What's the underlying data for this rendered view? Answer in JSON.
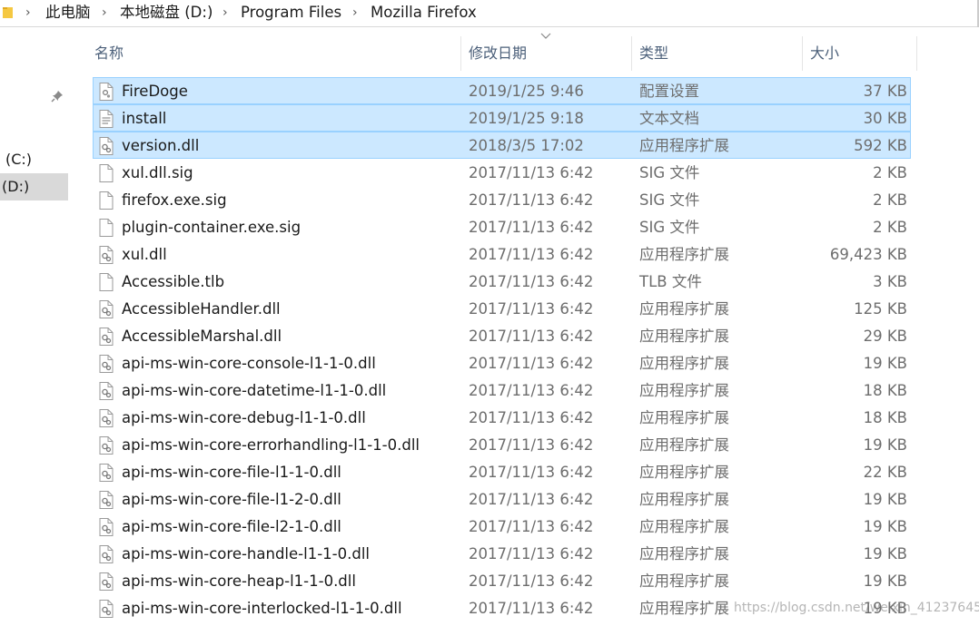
{
  "breadcrumb": [
    "此电脑",
    "本地磁盘 (D:)",
    "Program Files",
    "Mozilla Firefox"
  ],
  "nav": {
    "drive_c": "(C:)",
    "drive_d": "(D:)"
  },
  "columns": {
    "name": "名称",
    "date": "修改日期",
    "type": "类型",
    "size": "大小"
  },
  "files": [
    {
      "name": "FireDoge",
      "date": "2019/1/25 9:46",
      "type": "配置设置",
      "size": "37 KB",
      "icon": "config-file-icon",
      "selected": true
    },
    {
      "name": "install",
      "date": "2019/1/25 9:18",
      "type": "文本文档",
      "size": "30 KB",
      "icon": "text-file-icon",
      "selected": true
    },
    {
      "name": "version.dll",
      "date": "2018/3/5 17:02",
      "type": "应用程序扩展",
      "size": "592 KB",
      "icon": "dll-file-icon",
      "selected": true
    },
    {
      "name": "xul.dll.sig",
      "date": "2017/11/13 6:42",
      "type": "SIG 文件",
      "size": "2 KB",
      "icon": "blank-file-icon",
      "selected": false
    },
    {
      "name": "firefox.exe.sig",
      "date": "2017/11/13 6:42",
      "type": "SIG 文件",
      "size": "2 KB",
      "icon": "blank-file-icon",
      "selected": false
    },
    {
      "name": "plugin-container.exe.sig",
      "date": "2017/11/13 6:42",
      "type": "SIG 文件",
      "size": "2 KB",
      "icon": "blank-file-icon",
      "selected": false
    },
    {
      "name": "xul.dll",
      "date": "2017/11/13 6:42",
      "type": "应用程序扩展",
      "size": "69,423 KB",
      "icon": "dll-file-icon",
      "selected": false
    },
    {
      "name": "Accessible.tlb",
      "date": "2017/11/13 6:42",
      "type": "TLB 文件",
      "size": "3 KB",
      "icon": "blank-file-icon",
      "selected": false
    },
    {
      "name": "AccessibleHandler.dll",
      "date": "2017/11/13 6:42",
      "type": "应用程序扩展",
      "size": "125 KB",
      "icon": "dll-file-icon",
      "selected": false
    },
    {
      "name": "AccessibleMarshal.dll",
      "date": "2017/11/13 6:42",
      "type": "应用程序扩展",
      "size": "29 KB",
      "icon": "dll-file-icon",
      "selected": false
    },
    {
      "name": "api-ms-win-core-console-l1-1-0.dll",
      "date": "2017/11/13 6:42",
      "type": "应用程序扩展",
      "size": "19 KB",
      "icon": "dll-file-icon",
      "selected": false
    },
    {
      "name": "api-ms-win-core-datetime-l1-1-0.dll",
      "date": "2017/11/13 6:42",
      "type": "应用程序扩展",
      "size": "18 KB",
      "icon": "dll-file-icon",
      "selected": false
    },
    {
      "name": "api-ms-win-core-debug-l1-1-0.dll",
      "date": "2017/11/13 6:42",
      "type": "应用程序扩展",
      "size": "18 KB",
      "icon": "dll-file-icon",
      "selected": false
    },
    {
      "name": "api-ms-win-core-errorhandling-l1-1-0.dll",
      "date": "2017/11/13 6:42",
      "type": "应用程序扩展",
      "size": "19 KB",
      "icon": "dll-file-icon",
      "selected": false
    },
    {
      "name": "api-ms-win-core-file-l1-1-0.dll",
      "date": "2017/11/13 6:42",
      "type": "应用程序扩展",
      "size": "22 KB",
      "icon": "dll-file-icon",
      "selected": false
    },
    {
      "name": "api-ms-win-core-file-l1-2-0.dll",
      "date": "2017/11/13 6:42",
      "type": "应用程序扩展",
      "size": "19 KB",
      "icon": "dll-file-icon",
      "selected": false
    },
    {
      "name": "api-ms-win-core-file-l2-1-0.dll",
      "date": "2017/11/13 6:42",
      "type": "应用程序扩展",
      "size": "19 KB",
      "icon": "dll-file-icon",
      "selected": false
    },
    {
      "name": "api-ms-win-core-handle-l1-1-0.dll",
      "date": "2017/11/13 6:42",
      "type": "应用程序扩展",
      "size": "19 KB",
      "icon": "dll-file-icon",
      "selected": false
    },
    {
      "name": "api-ms-win-core-heap-l1-1-0.dll",
      "date": "2017/11/13 6:42",
      "type": "应用程序扩展",
      "size": "19 KB",
      "icon": "dll-file-icon",
      "selected": false
    },
    {
      "name": "api-ms-win-core-interlocked-l1-1-0.dll",
      "date": "2017/11/13 6:42",
      "type": "应用程序扩展",
      "size": "19 KB",
      "icon": "dll-file-icon",
      "selected": false
    }
  ],
  "watermark": "https://blog.csdn.net/weixin_41237645",
  "colors": {
    "selection_bg": "#cce8ff",
    "selection_border": "#99d1ff",
    "header_text": "#4c607a",
    "secondary_text": "#6d6d6d"
  }
}
